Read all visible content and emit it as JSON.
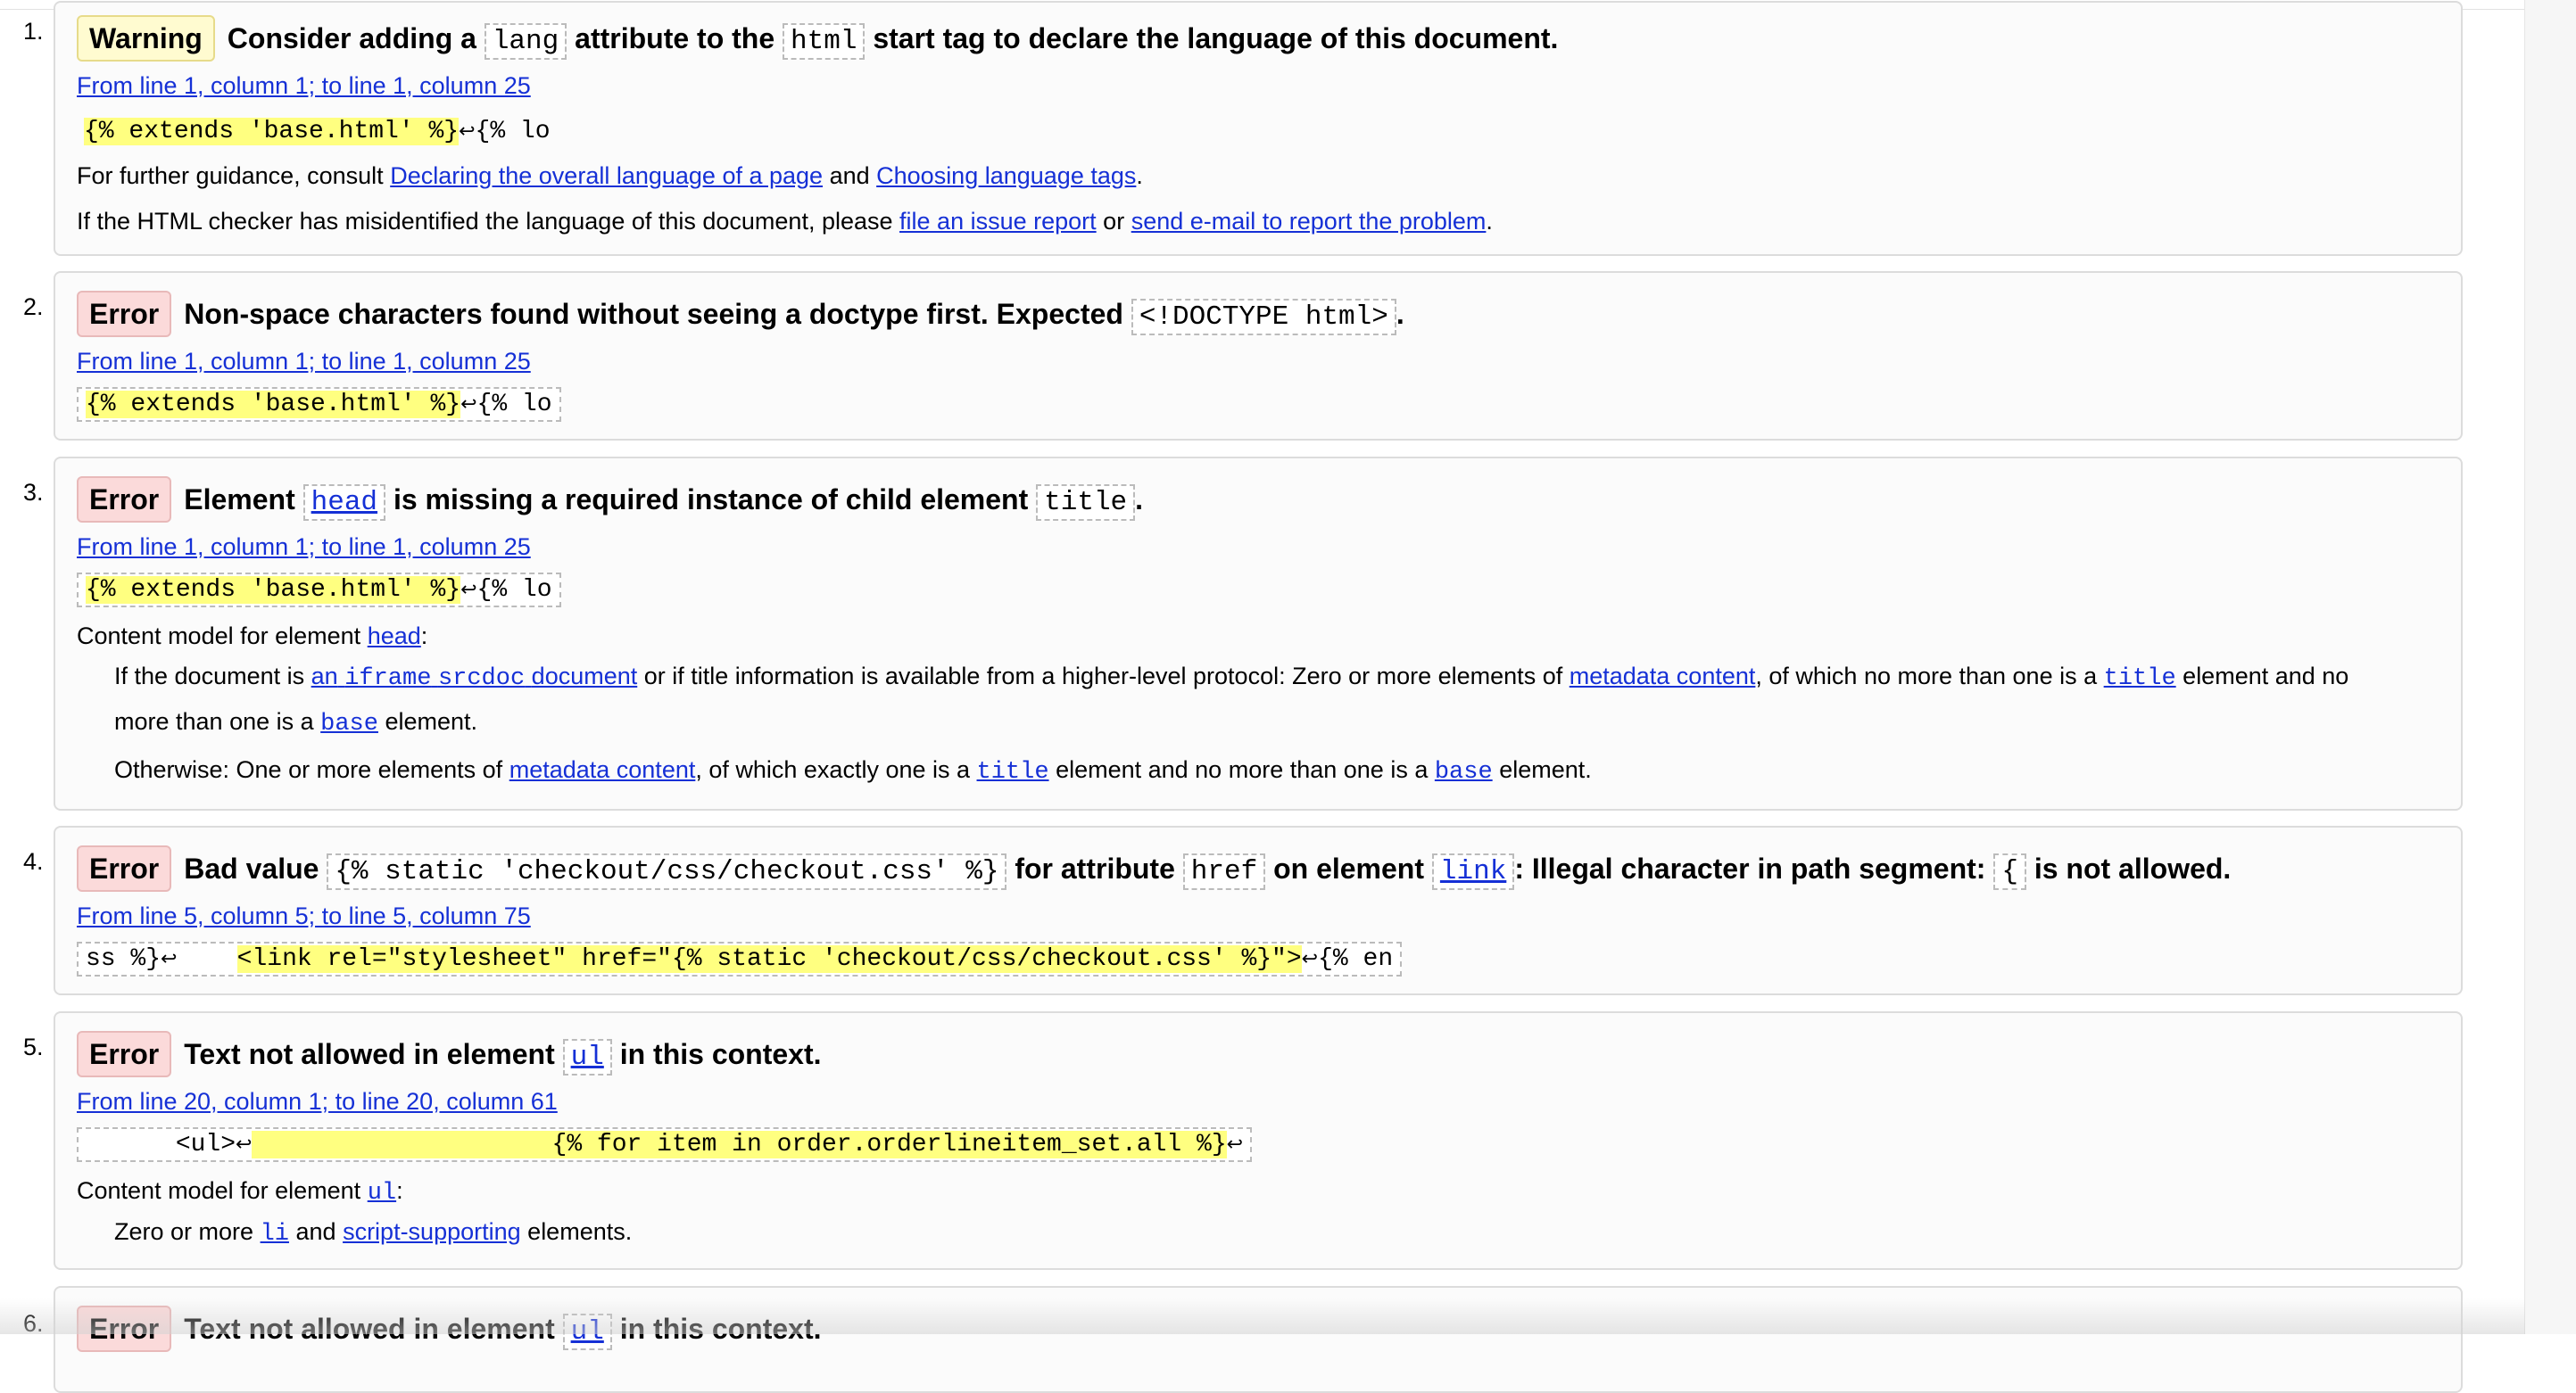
{
  "messages": [
    {
      "number": "1.",
      "type": "Warning",
      "title_a": "Consider adding a",
      "code_1": "lang",
      "title_b": "attribute to the",
      "code_2": "html",
      "title_c": "start tag to declare the language of this document.",
      "location": "From line 1, column 1; to line 1, column 25",
      "extract": "{% extends 'base.html' %}",
      "extract_tail": "{% lo",
      "guidance_prefix": "For further guidance, consult",
      "guidance_link_1": "Declaring the overall language of a page",
      "guidance_and": "and",
      "guidance_link_2": "Choosing language tags",
      "misid_prefix": "If the HTML checker has misidentified the language of this document, please",
      "misid_link_1": "file an issue report",
      "misid_or": "or",
      "misid_link_2": "send e-mail to report the problem"
    },
    {
      "number": "2.",
      "type": "Error",
      "title_a": "Non-space characters found without seeing a doctype first. Expected",
      "code_1": "<!DOCTYPE html>",
      "location": "From line 1, column 1; to line 1, column 25",
      "extract": "{% extends 'base.html' %}",
      "extract_tail": "{% lo"
    },
    {
      "number": "3.",
      "type": "Error",
      "title_a": "Element",
      "code_link_1": "head",
      "title_b": "is missing a required instance of child element",
      "code_2": "title",
      "location": "From line 1, column 1; to line 1, column 25",
      "extract": "{% extends 'base.html' %}",
      "extract_tail": "{% lo",
      "content_model_prefix": "Content model for element",
      "content_model_element": "head",
      "rule1_prefix": "If the document is",
      "rule1_link_a": "an",
      "rule1_link_code_a": "iframe",
      "rule1_link_code_b": "srcdoc",
      "rule1_link_b": "document",
      "rule1_mid": "or if title information is available from a higher-level protocol: Zero or more elements of",
      "rule1_link_metadata": "metadata content",
      "rule1_mid2": ", of which no more than one is a",
      "rule1_code_title": "title",
      "rule1_mid3": "element and no",
      "rule1_line2_prefix": "more than one is a",
      "rule1_code_base": "base",
      "rule1_line2_suffix": "element.",
      "rule2_prefix": "Otherwise: One or more elements of",
      "rule2_link_metadata": "metadata content",
      "rule2_mid": ", of which exactly one is a",
      "rule2_code_title": "title",
      "rule2_mid2": "element and no more than one is a",
      "rule2_code_base": "base",
      "rule2_suffix": "element."
    },
    {
      "number": "4.",
      "type": "Error",
      "title_a": "Bad value",
      "code_1": "{% static 'checkout/css/checkout.css' %}",
      "title_b": "for attribute",
      "code_2": "href",
      "title_c": "on element",
      "code_link_3": "link",
      "title_d": ": Illegal character in path segment:",
      "code_4": "{",
      "title_e": "is not allowed.",
      "location": "From line 5, column 5; to line 5, column 75",
      "extract_pre": "ss %}",
      "extract_gap": "    ",
      "extract": "<link rel=\"stylesheet\" href=\"{% static 'checkout/css/checkout.css' %}\">",
      "extract_tail": "{% en"
    },
    {
      "number": "5.",
      "type": "Error",
      "title_a": "Text not allowed in element",
      "code_link_1": "ul",
      "title_b": "in this context.",
      "location": "From line 20, column 1; to line 20, column 61",
      "extract_pre": "      <ul>",
      "extract": "                    {% for item in order.orderlineitem_set.all %}",
      "content_model_prefix": "Content model for element",
      "content_model_element": "ul",
      "rule_prefix": "Zero or more",
      "rule_code_li": "li",
      "rule_and": "and",
      "rule_link_script": "script-supporting",
      "rule_suffix": "elements."
    },
    {
      "number": "6.",
      "type": "Error",
      "title_a": "Text not allowed in element",
      "code_link_1": "ul",
      "title_b": "in this context."
    }
  ],
  "glyphs": {
    "return_symbol": "↩",
    "colon": ":",
    "period": "."
  },
  "colors": {
    "link": "#1530d6",
    "warning_bg": "#fffbd0",
    "error_bg": "#fbdada",
    "highlight": "#ffff80"
  }
}
